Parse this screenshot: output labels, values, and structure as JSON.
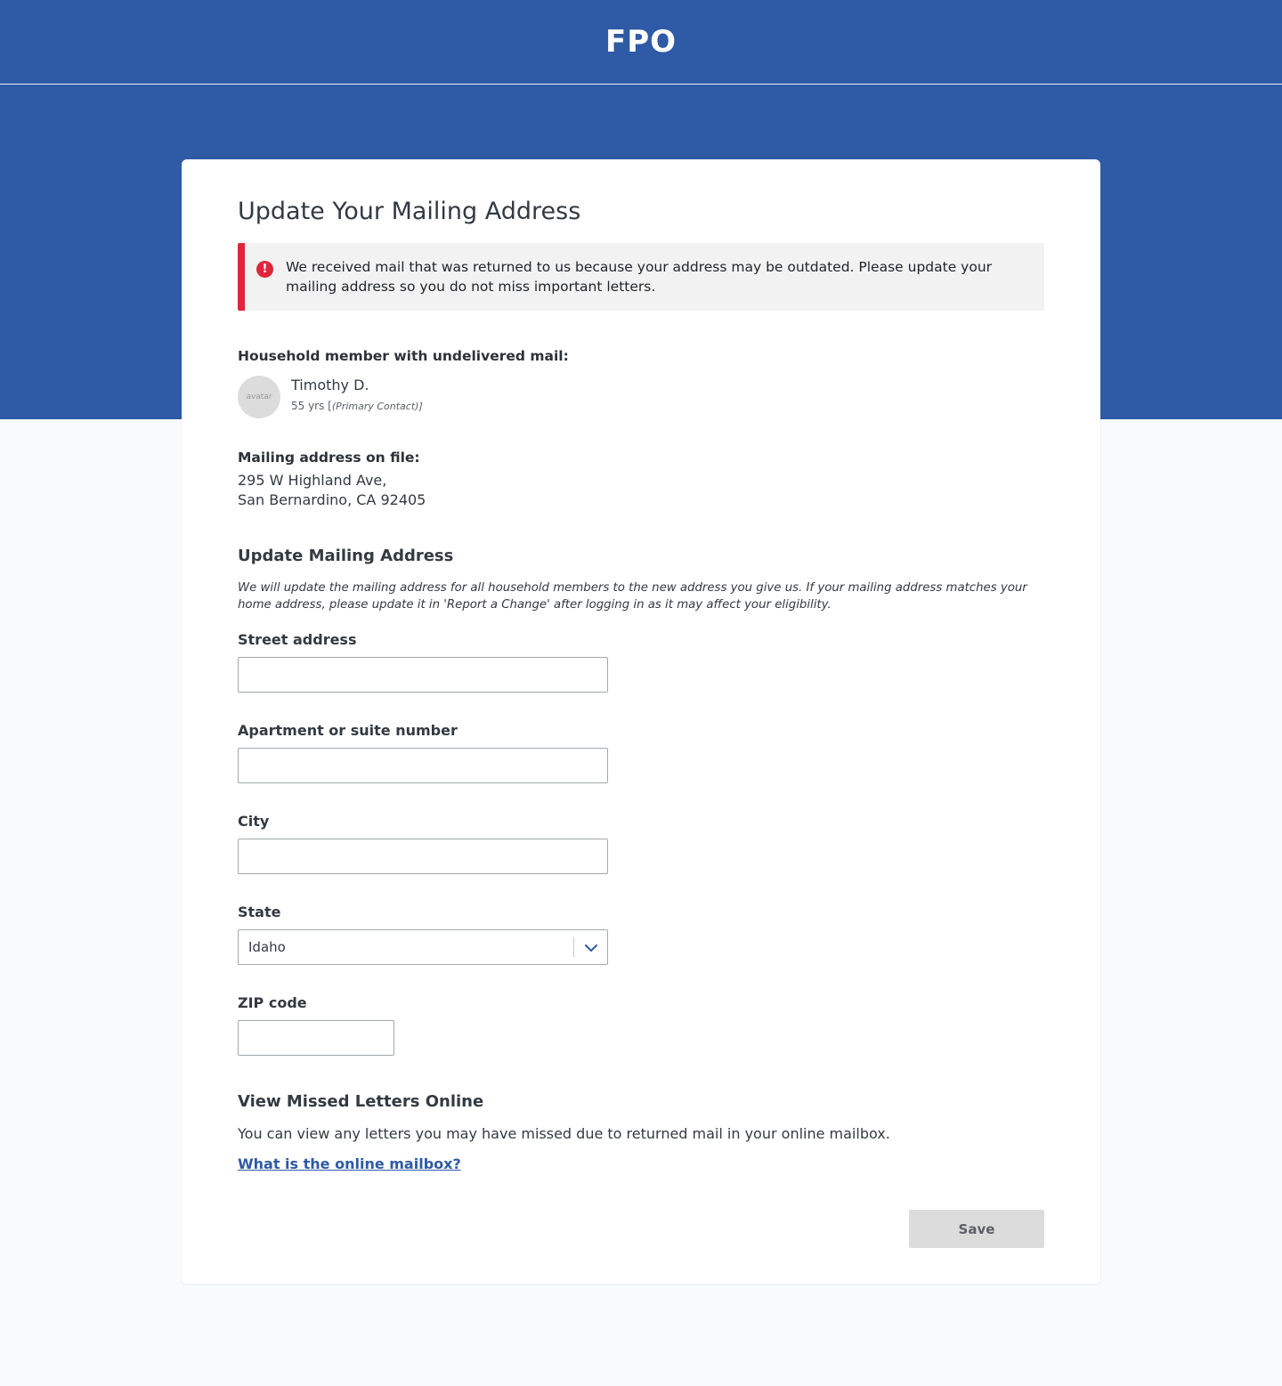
{
  "header": {
    "brand": "FPO"
  },
  "page": {
    "title": "Update Your Mailing Address"
  },
  "alert": {
    "icon": "alert-circle-icon",
    "message": "We received mail that was returned to us because your address may be outdated. Please update your mailing address so you do not miss important letters."
  },
  "member": {
    "section_label": "Household member with undelivered mail:",
    "avatar_text": "avatar",
    "name": "Timothy D.",
    "age": "55 yrs [",
    "role": "(Primary Contact)]"
  },
  "address_on_file": {
    "label": "Mailing address on file:",
    "line1": "295 W Highland Ave,",
    "line2": "San Bernardino, CA 92405"
  },
  "update_section": {
    "title": "Update Mailing Address",
    "note": "We will update the mailing address for all household members to the new address you give us. If your mailing address matches your home address, please update it in 'Report a Change' after logging in as it may affect your eligibility."
  },
  "form": {
    "street": {
      "label": "Street address",
      "value": ""
    },
    "apartment": {
      "label": "Apartment or suite number",
      "value": ""
    },
    "city": {
      "label": "City",
      "value": ""
    },
    "state": {
      "label": "State",
      "value": "Idaho",
      "icon": "chevron-down-icon"
    },
    "zip": {
      "label": "ZIP code",
      "value": ""
    }
  },
  "missed_letters": {
    "title": "View Missed Letters Online",
    "text": "You can view any letters you may have missed due to returned mail in your online mailbox.",
    "link": "What is the online mailbox?"
  },
  "actions": {
    "save_label": "Save"
  },
  "colors": {
    "brand_blue": "#2e5aa6",
    "alert_red": "#e0263a",
    "disabled_button": "#dcdcdc"
  }
}
